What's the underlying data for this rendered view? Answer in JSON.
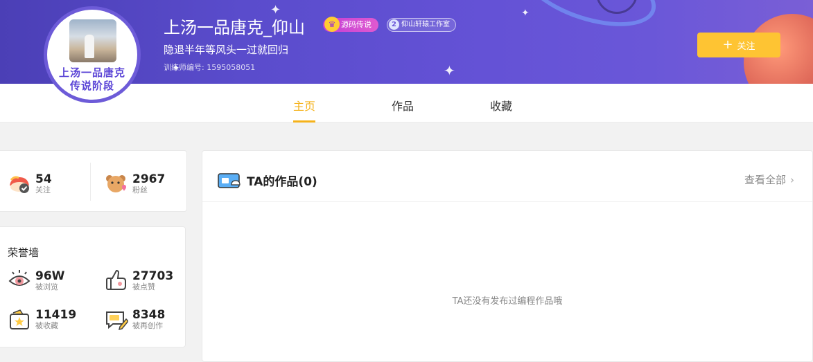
{
  "profile": {
    "avatar_line1": "上汤一品唐克",
    "avatar_line2": "传说阶段",
    "name": "上汤一品唐克_仰山",
    "badge_legend": "源码传说",
    "badge_studio_num": "2",
    "badge_studio": "仰山轩辕工作室",
    "motto": "隐退半年等风头一过就回归",
    "trainer_id": "训练师编号: 1595058051",
    "follow_label": "关注"
  },
  "tabs": [
    {
      "label": "主页",
      "active": true
    },
    {
      "label": "作品",
      "active": false
    },
    {
      "label": "收藏",
      "active": false
    }
  ],
  "stats": {
    "following": {
      "value": "54",
      "label": "关注"
    },
    "fans": {
      "value": "2967",
      "label": "粉丝"
    }
  },
  "honor": {
    "title": "荣誉墙",
    "views": {
      "value": "96W",
      "label": "被浏览"
    },
    "likes": {
      "value": "27703",
      "label": "被点赞"
    },
    "favorites": {
      "value": "11419",
      "label": "被收藏"
    },
    "remixes": {
      "value": "8348",
      "label": "被再创作"
    }
  },
  "works": {
    "title": "TA的作品(0)",
    "view_all": "查看全部",
    "empty_message": "TA还没有发布过编程作品哦"
  },
  "colors": {
    "accent": "#f5b21a",
    "follow_button": "#fec433",
    "banner": "#5a4ccc"
  }
}
